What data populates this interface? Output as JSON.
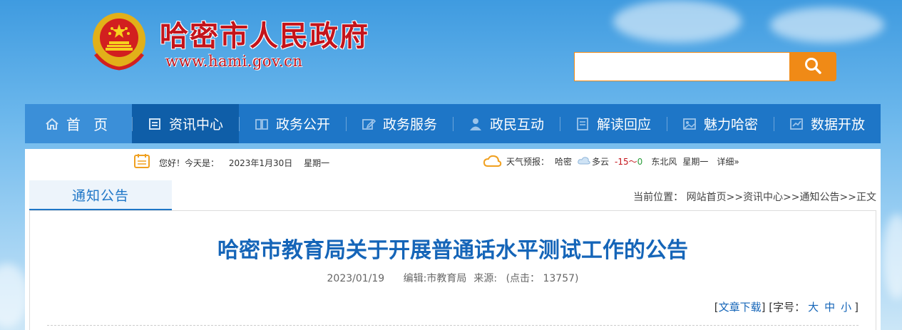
{
  "site": {
    "title": "哈密市人民政府",
    "url": "www.hami.gov.cn"
  },
  "search": {
    "placeholder": "",
    "value": ""
  },
  "nav": {
    "items": [
      {
        "label": "首 页",
        "icon": "home-icon"
      },
      {
        "label": "资讯中心",
        "icon": "news-icon"
      },
      {
        "label": "政务公开",
        "icon": "book-icon"
      },
      {
        "label": "政务服务",
        "icon": "edit-icon"
      },
      {
        "label": "政民互动",
        "icon": "user-icon"
      },
      {
        "label": "解读回应",
        "icon": "document-icon"
      },
      {
        "label": "魅力哈密",
        "icon": "image-icon"
      },
      {
        "label": "数据开放",
        "icon": "chart-icon"
      }
    ],
    "active": "资讯中心"
  },
  "info_bar": {
    "greeting": "您好！今天是：",
    "date": "2023年1月30日",
    "weekday": "星期一",
    "weather_label": "天气预报：",
    "city": "哈密",
    "condition": "多云",
    "temp_low": "-15",
    "temp_sep": "～",
    "temp_high": "0",
    "wind": "东北风",
    "forecast_day": "星期一",
    "detail_link": "详细»"
  },
  "tab": {
    "label": "通知公告"
  },
  "breadcrumb": {
    "prefix": "当前位置：",
    "items": [
      "网站首页",
      "资讯中心",
      "通知公告",
      "正文"
    ],
    "separator": ">>"
  },
  "article": {
    "title": "哈密市教育局关于开展普通话水平测试工作的公告",
    "date": "2023/01/19",
    "editor": "编辑:市教育局",
    "source": "来源:",
    "clicks": "(点击： 13757)",
    "download": "文章下载",
    "font_label": "字号：",
    "font_large": "大",
    "font_medium": "中",
    "font_small": "小"
  },
  "colors": {
    "brand_red": "#c4141b",
    "nav_blue": "#1e76c7",
    "accent_orange": "#f08a16",
    "title_blue": "#1565b8"
  }
}
